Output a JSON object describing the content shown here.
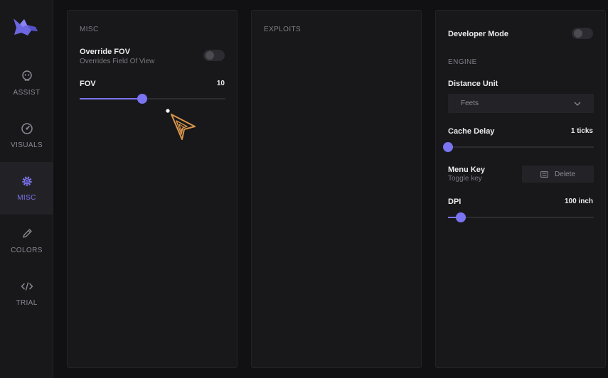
{
  "sidebar": {
    "items": [
      {
        "label": "ASSIST",
        "icon": "assist-icon"
      },
      {
        "label": "VISUALS",
        "icon": "visuals-icon"
      },
      {
        "label": "MISC",
        "icon": "gear-icon",
        "active": true
      },
      {
        "label": "COLORS",
        "icon": "pencil-icon"
      },
      {
        "label": "TRIAL",
        "icon": "code-icon"
      }
    ]
  },
  "misc": {
    "title": "MISC",
    "override_fov": {
      "label": "Override FOV",
      "sub": "Overrides Field Of View",
      "enabled": false
    },
    "fov": {
      "label": "FOV",
      "value": "10",
      "fill_fraction": 0.43
    }
  },
  "exploits": {
    "title": "EXPLOITS"
  },
  "settings": {
    "developer_mode": {
      "label": "Developer Mode",
      "enabled": false
    },
    "engine_title": "ENGINE",
    "distance_unit": {
      "label": "Distance Unit",
      "value": "Feets"
    },
    "cache_delay": {
      "label": "Cache Delay",
      "value": "1 ticks",
      "fill_fraction": 0.0
    },
    "menu_key": {
      "label": "Menu Key",
      "sub": "Toggle key",
      "button_label": "Delete"
    },
    "dpi": {
      "label": "DPI",
      "value": "100 inch",
      "fill_fraction": 0.09
    }
  },
  "colors": {
    "accent": "#7b74f0",
    "panel": "#18181b",
    "background": "#111113"
  }
}
